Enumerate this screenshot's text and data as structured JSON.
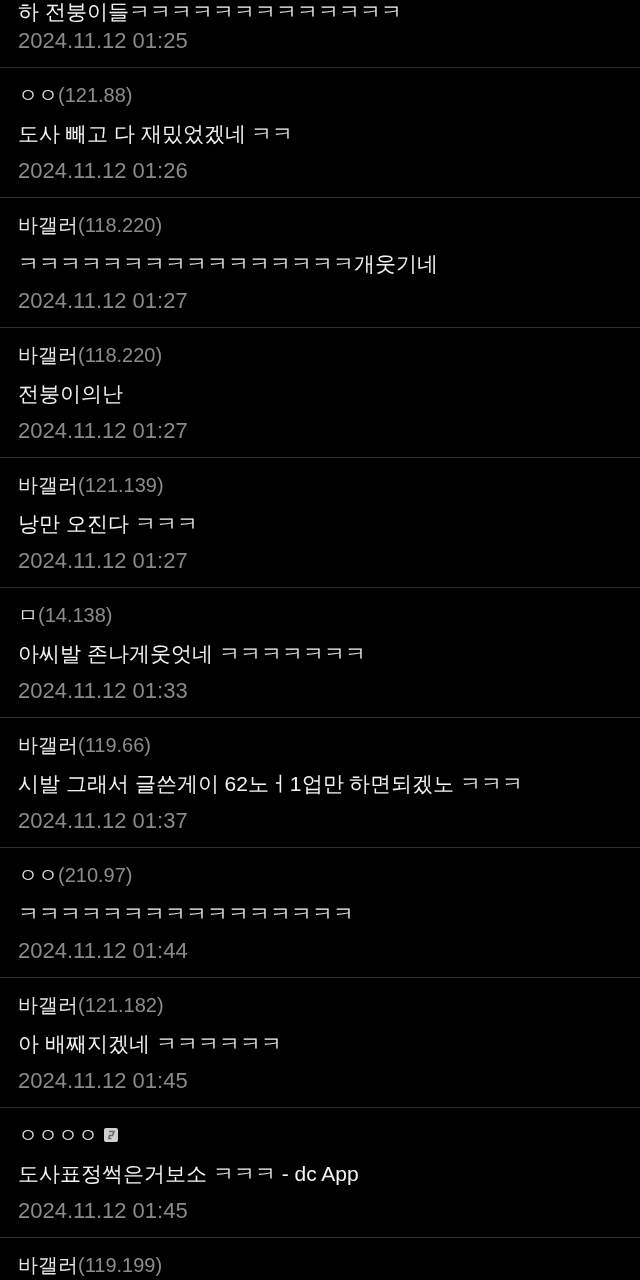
{
  "comments": [
    {
      "text": "하 전붕이들ㅋㅋㅋㅋㅋㅋㅋㅋㅋㅋㅋㅋㅋ",
      "date": "2024.11.12 01:25"
    },
    {
      "author": "ㅇㅇ",
      "ip": "(121.88)",
      "badge": false,
      "text": "도사 빼고 다 재밌었겠네 ㅋㅋ",
      "date": "2024.11.12 01:26"
    },
    {
      "author": "바갤러",
      "ip": "(118.220)",
      "badge": false,
      "text": "ㅋㅋㅋㅋㅋㅋㅋㅋㅋㅋㅋㅋㅋㅋㅋㅋ개웃기네",
      "date": "2024.11.12 01:27"
    },
    {
      "author": "바갤러",
      "ip": "(118.220)",
      "badge": false,
      "text": "전붕이의난",
      "date": "2024.11.12 01:27"
    },
    {
      "author": "바갤러",
      "ip": "(121.139)",
      "badge": false,
      "text": "낭만 오진다 ㅋㅋㅋ",
      "date": "2024.11.12 01:27"
    },
    {
      "author": "ㅁ",
      "ip": "(14.138)",
      "badge": false,
      "text": "아씨발 존나게웃엇네 ㅋㅋㅋㅋㅋㅋㅋ",
      "date": "2024.11.12 01:33"
    },
    {
      "author": "바갤러",
      "ip": "(119.66)",
      "badge": false,
      "text": "시발 그래서 글쓴게이 62노ㅓ1업만 하면되겠노 ㅋㅋㅋ",
      "date": "2024.11.12 01:37"
    },
    {
      "author": "ㅇㅇ",
      "ip": "(210.97)",
      "badge": false,
      "text": "ㅋㅋㅋㅋㅋㅋㅋㅋㅋㅋㅋㅋㅋㅋㅋㅋ",
      "date": "2024.11.12 01:44"
    },
    {
      "author": "바갤러",
      "ip": "(121.182)",
      "badge": false,
      "text": "아 배째지겠네 ㅋㅋㅋㅋㅋㅋ",
      "date": "2024.11.12 01:45"
    },
    {
      "author": "ㅇㅇㅇㅇ",
      "badge": true,
      "text": "도사표정썩은거보소 ㅋㅋㅋ - dc App",
      "date": "2024.11.12 01:45"
    },
    {
      "author": "바갤러",
      "ip": "(119.199)",
      "badge": false
    }
  ]
}
